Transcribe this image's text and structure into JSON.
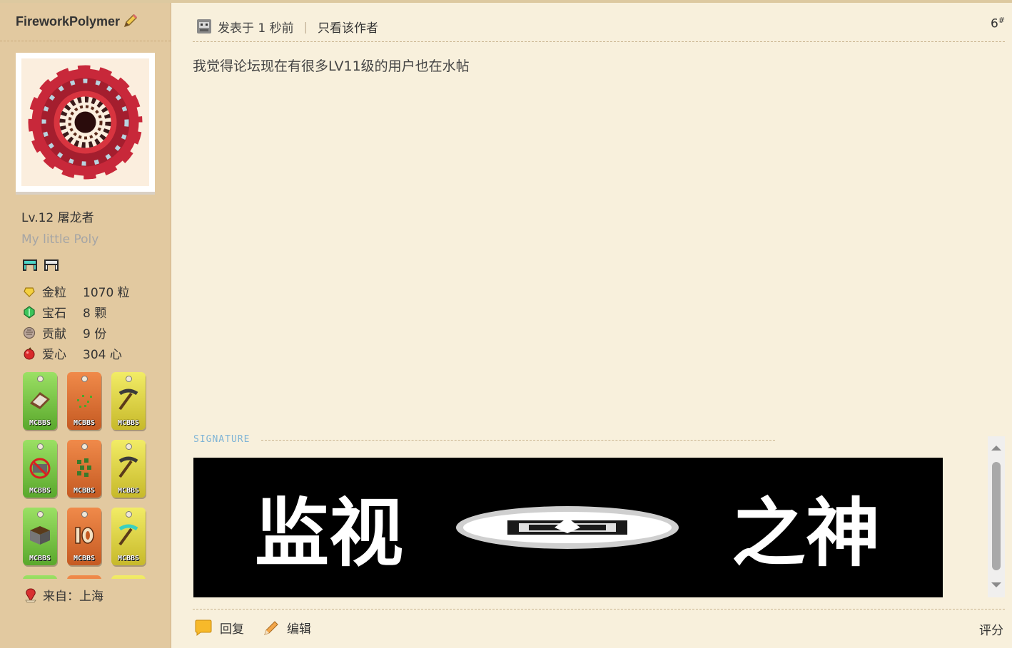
{
  "user": {
    "name": "FireworkPolymer",
    "level": "Lv.12 屠龙者",
    "custom_title": "My little Poly",
    "stats": [
      {
        "icon": "gold-nugget-icon",
        "label": "金粒",
        "value": "1070 粒"
      },
      {
        "icon": "emerald-icon",
        "label": "宝石",
        "value": "8 颗"
      },
      {
        "icon": "contribution-icon",
        "label": "贡献",
        "value": "9 份"
      },
      {
        "icon": "apple-heart-icon",
        "label": "爱心",
        "value": "304 心"
      }
    ],
    "badges": [
      {
        "color": "green",
        "tag": "MCBBS",
        "icon": "book-icon"
      },
      {
        "color": "orange",
        "tag": "MCBBS",
        "icon": "seeds-icon"
      },
      {
        "color": "yellow",
        "tag": "MCBBS",
        "icon": "pickaxe-icon"
      },
      {
        "color": "green",
        "tag": "MCBBS",
        "icon": "no-minecart-icon"
      },
      {
        "color": "orange",
        "tag": "MCBBS",
        "icon": "leaves-icon"
      },
      {
        "color": "yellow",
        "tag": "MCBBS",
        "icon": "pickaxe-icon"
      },
      {
        "color": "green",
        "tag": "MCBBS",
        "icon": "dirt-block-icon"
      },
      {
        "color": "orange",
        "tag": "MCBBS",
        "icon": "number-10-icon"
      },
      {
        "color": "yellow",
        "tag": "MCBBS",
        "icon": "diamond-pickaxe-icon"
      }
    ],
    "location": "来自：上海"
  },
  "post": {
    "time": "发表于 1 秒前",
    "only_author": "只看该作者",
    "floor": "6",
    "floor_mark": "#",
    "content": "我觉得论坛现在有很多LV11级的用户也在水帖",
    "signature_label": "SIGNATURE",
    "signature_banner": {
      "left_text": "监视",
      "right_text": "之神"
    }
  },
  "actions": {
    "reply": "回复",
    "edit": "编辑",
    "rate": "评分"
  },
  "colors": {
    "sidebar_bg": "#e2c9a0",
    "main_bg": "#f8f0dc",
    "signature_label": "#7fb4d6"
  }
}
